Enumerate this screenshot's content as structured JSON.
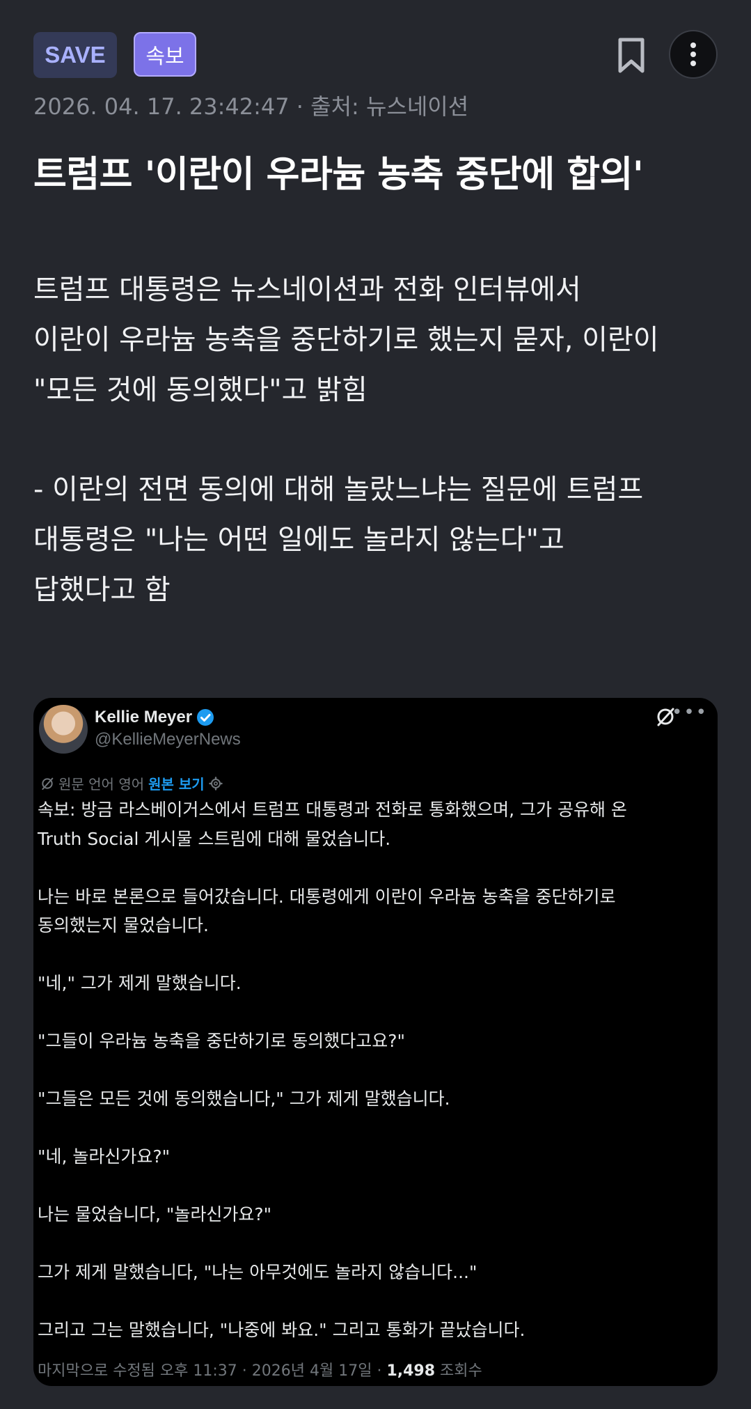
{
  "header": {
    "save_badge": "SAVE",
    "breaking_badge": "속보"
  },
  "meta": {
    "datetime": "2026. 04. 17. 23:42:47",
    "separator": "·",
    "source": "출처: 뉴스네이션"
  },
  "headline": "트럼프 '이란이 우라늄 농축 중단에 합의'",
  "paragraphs": [
    [
      "트럼프 대통령은 뉴스네이션과 전화 인터뷰에서",
      "이란이 우라늄 농축을 중단하기로 했는지 묻자, 이란이",
      "\"모든 것에 동의했다\"고 밝힘"
    ],
    [
      "- 이란의 전면 동의에 대해 놀랐느냐는 질문에 트럼프",
      "대통령은 \"나는 어떤 일에도 놀라지 않는다\"고",
      "답했다고 함"
    ]
  ],
  "tweet": {
    "name": "Kellie Meyer",
    "handle": "@KellieMeyerNews",
    "translation_note": "원문 언어 영어",
    "show_original": "원본 보기",
    "lines": [
      "속보: 방금 라스베이거스에서 트럼프 대통령과 전화로 통화했으며, 그가 공유해 온",
      "Truth Social 게시물 스트림에 대해 물었습니다.",
      "",
      "나는 바로 본론으로 들어갔습니다. 대통령에게 이란이 우라늄 농축을 중단하기로",
      "동의했는지 물었습니다.",
      "",
      "\"네,\" 그가 제게 말했습니다.",
      "",
      "\"그들이 우라늄 농축을 중단하기로 동의했다고요?\"",
      "",
      "\"그들은 모든 것에 동의했습니다,\" 그가 제게 말했습니다.",
      "",
      "\"네, 놀라신가요?\"",
      "",
      "나는 물었습니다, \"놀라신가요?\"",
      "",
      "그가 제게 말했습니다, \"나는 아무것에도 놀라지 않습니다...\"",
      "",
      "그리고 그는 말했습니다, \"나중에 봐요.\" 그리고 통화가 끝났습니다."
    ],
    "footer_edited": "마지막으로 수정됨 오후 11:37 · 2026년 4월 17일 ·",
    "views_count": "1,498",
    "views_label": "조회수"
  },
  "colors": {
    "background": "#25272d",
    "save_badge_bg": "#343a57",
    "breaking_badge_bg": "#7c72e8",
    "link": "#1d9bf0",
    "verified": "#1d9bf0"
  }
}
